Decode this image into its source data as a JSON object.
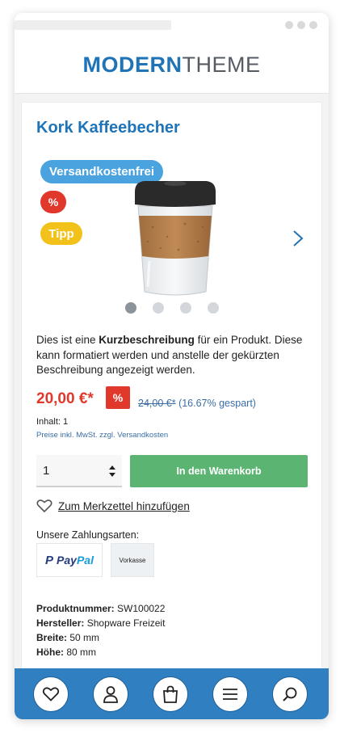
{
  "header": {
    "logo_bold": "MODERN",
    "logo_thin": "THEME"
  },
  "product": {
    "title": "Kork Kaffeebecher",
    "badges": {
      "shipping": "Versandkostenfrei",
      "discount": "%",
      "tip": "Tipp"
    },
    "carousel": {
      "slide_count": 4,
      "active_slide": 1
    },
    "description_pre": "Dies ist eine ",
    "description_bold": "Kurzbeschreibung",
    "description_post": " für ein Produkt. Diese kann formatiert werden und anstelle der gekürzten Beschreibung angezeigt werden.",
    "price": "20,00 €*",
    "price_badge": "%",
    "old_price": "24,00 €*",
    "savings": "(16.67% gespart)",
    "content_label": "Inhalt: 1",
    "tax_note": "Preise inkl. MwSt. zzgl. Versandkosten"
  },
  "purchase": {
    "quantity": "1",
    "add_to_cart": "In den Warenkorb",
    "wishlist": "Zum Merkzettel hinzufügen"
  },
  "payment": {
    "title": "Unsere Zahlungsarten:",
    "paypal_a": "Pay",
    "paypal_b": "Pal",
    "vorkasse": "Vorkasse"
  },
  "properties": [
    {
      "key": "Produktnummer:",
      "value": "SW100022"
    },
    {
      "key": "Hersteller:",
      "value": "Shopware Freizeit"
    },
    {
      "key": "Breite:",
      "value": "50 mm"
    },
    {
      "key": "Höhe:",
      "value": "80 mm"
    }
  ],
  "bottom_nav": [
    "heart-icon",
    "user-icon",
    "bag-icon",
    "menu-icon",
    "search-icon"
  ],
  "colors": {
    "brand": "#1f73b7",
    "price": "#e0392b",
    "cart": "#5bb472",
    "nav": "#2f7fc1",
    "shipping_badge": "#4aa3df",
    "tip_badge": "#f2c21b"
  }
}
